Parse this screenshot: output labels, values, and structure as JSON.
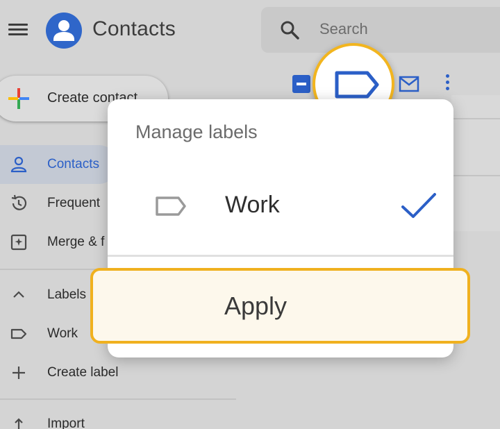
{
  "header": {
    "app_title": "Contacts",
    "menu_icon": "hamburger-menu-icon",
    "avatar_icon": "person-avatar-icon",
    "search": {
      "placeholder": "Search",
      "icon": "search-icon"
    }
  },
  "toolbar": {
    "select_icon": "select-checkbox-icon",
    "label_icon": "label-icon",
    "email_icon": "email-icon",
    "more_icon": "more-vert-icon"
  },
  "sidebar": {
    "create_contact": {
      "label": "Create contact",
      "icon": "plus-icon"
    },
    "items": [
      {
        "label": "Contacts",
        "icon": "person-icon",
        "active": true
      },
      {
        "label": "Frequent",
        "icon": "history-icon"
      },
      {
        "label": "Merge & f",
        "icon": "merge-icon"
      }
    ],
    "labels_section": {
      "label": "Labels",
      "icon": "chevron-up-icon"
    },
    "label_items": [
      {
        "label": "Work",
        "icon": "label-icon"
      }
    ],
    "create_label": {
      "label": "Create label",
      "icon": "plus-icon"
    },
    "import": {
      "label": "Import",
      "icon": "upload-icon"
    }
  },
  "dialog": {
    "title": "Manage labels",
    "labels": [
      {
        "label": "Work",
        "checked": true
      }
    ],
    "apply_label": "Apply"
  },
  "colors": {
    "accent": "#2b5fc7",
    "highlight": "#f0b11f",
    "background": "#d4d4d4"
  }
}
